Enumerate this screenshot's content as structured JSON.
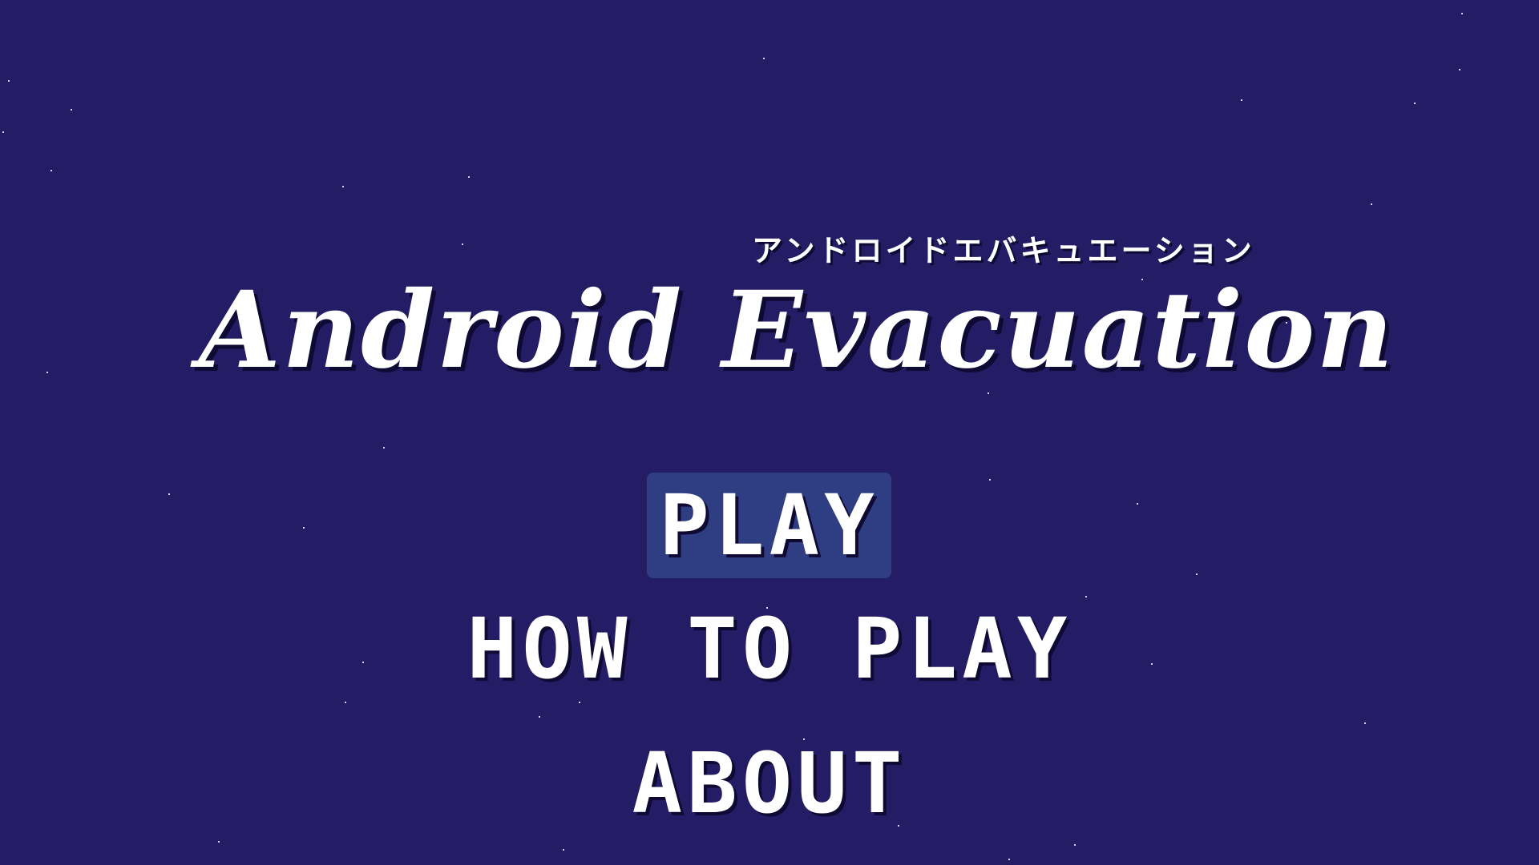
{
  "game": {
    "subtitle_jp": "アンドロイドエバキュエーション",
    "title": "Android Evacuation"
  },
  "menu": {
    "play": "PLAY",
    "how_to_play": "HOW TO PLAY",
    "about": "ABOUT",
    "selected": "PLAY"
  },
  "colors": {
    "background": "#241c64",
    "selected_highlight": "#2f3d82",
    "text": "#ffffff"
  }
}
